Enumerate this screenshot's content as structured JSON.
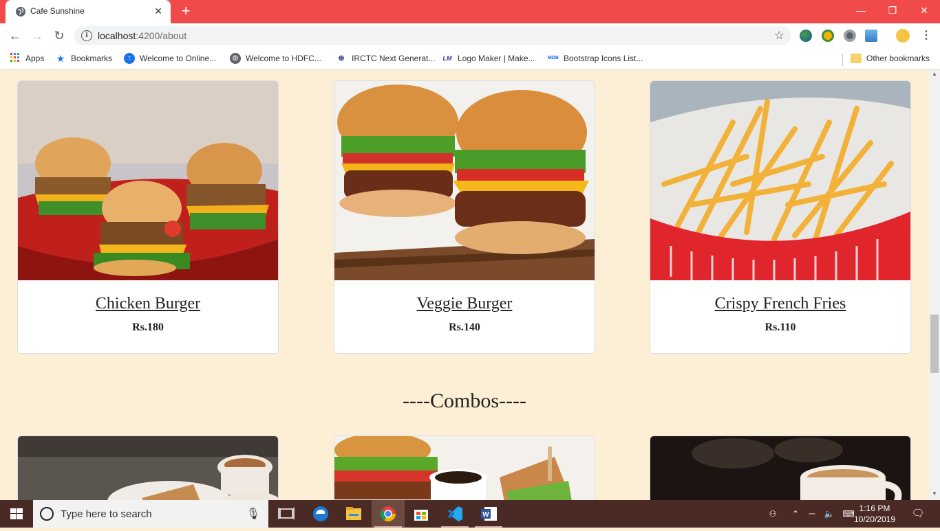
{
  "browser": {
    "tab_title": "Cafe Sunshine",
    "tab_close": "✕",
    "new_tab": "+",
    "window_controls": {
      "minimize": "—",
      "restore": "❐",
      "close": "✕"
    },
    "url_host": "localhost",
    "url_rest": ":4200/about",
    "bookmarks": [
      {
        "label": "Apps",
        "icon": "apps-grid-icon"
      },
      {
        "label": "Bookmarks",
        "icon": "star-icon"
      },
      {
        "label": "Welcome to Online...",
        "icon": "info-circle-icon"
      },
      {
        "label": "Welcome to HDFC...",
        "icon": "globe-icon"
      },
      {
        "label": "IRCTC Next Generat...",
        "icon": "irctc-logo-icon"
      },
      {
        "label": "Logo Maker | Make...",
        "icon": "lm-logo-icon"
      },
      {
        "label": "Bootstrap Icons List...",
        "icon": "mdb-logo-icon"
      }
    ],
    "other_bookmarks": "Other bookmarks"
  },
  "page": {
    "items": [
      {
        "name": "Chicken Burger",
        "price": "Rs.180"
      },
      {
        "name": "Veggie Burger",
        "price": "Rs.140"
      },
      {
        "name": "Crispy French Fries",
        "price": "Rs.110"
      }
    ],
    "section_heading": "----Combos----"
  },
  "taskbar": {
    "search_placeholder": "Type here to search",
    "time": "1:16 PM",
    "date": "10/20/2019",
    "apps": [
      "task-view",
      "edge",
      "file-explorer",
      "chrome",
      "store",
      "vscode",
      "word"
    ]
  },
  "colors": {
    "titlebar": "#f04a4a",
    "page_bg": "#fdeed6",
    "taskbar": "#4a2a24"
  }
}
